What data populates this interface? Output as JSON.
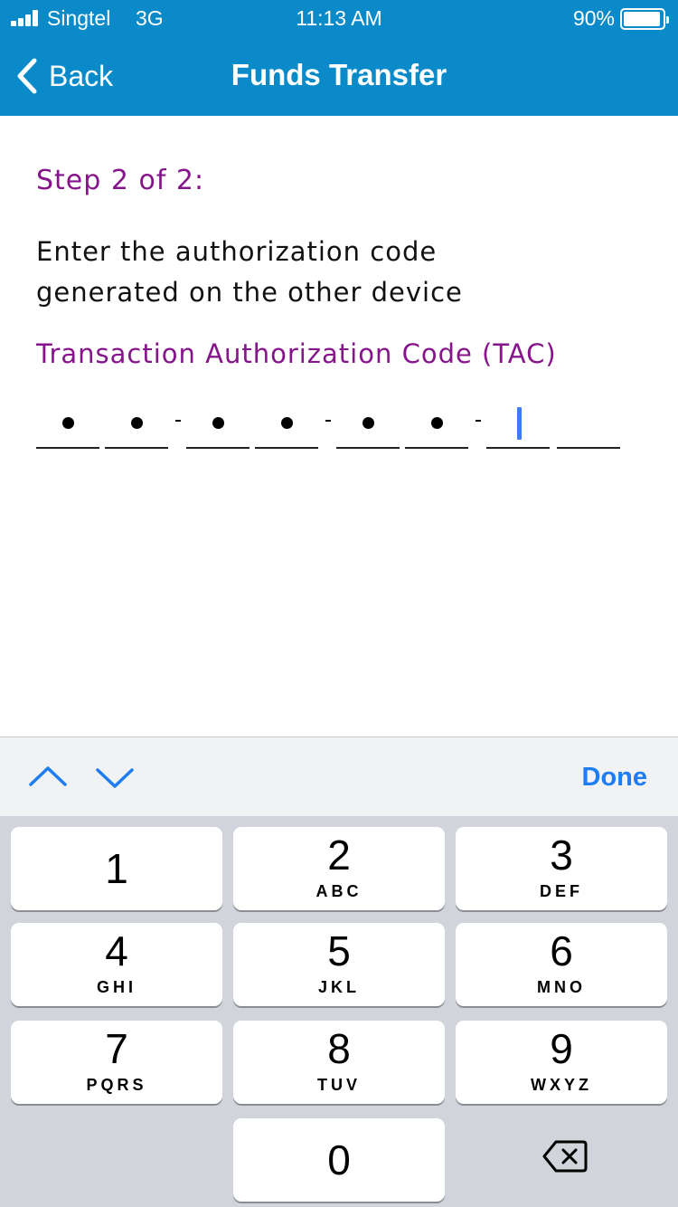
{
  "status_bar": {
    "carrier": "Singtel",
    "network": "3G",
    "time": "11:13 AM",
    "battery_percent": "90%",
    "battery_level": 0.9,
    "signal_bars": 4
  },
  "nav": {
    "back_label": "Back",
    "title": "Funds Transfer"
  },
  "content": {
    "step": "Step 2 of 2:",
    "instruction_line1": "Enter the authorization code",
    "instruction_line2": "generated on the other device",
    "tac_label": "Transaction Authorization Code (TAC)"
  },
  "tac": {
    "filled_digits": 6,
    "total_digits": 8
  },
  "accessory": {
    "prev_icon": "chevron-up-icon",
    "next_icon": "chevron-down-icon",
    "done_label": "Done"
  },
  "keypad": {
    "keys": [
      {
        "digit": "1",
        "letters": ""
      },
      {
        "digit": "2",
        "letters": "ABC"
      },
      {
        "digit": "3",
        "letters": "DEF"
      },
      {
        "digit": "4",
        "letters": "GHI"
      },
      {
        "digit": "5",
        "letters": "JKL"
      },
      {
        "digit": "6",
        "letters": "MNO"
      },
      {
        "digit": "7",
        "letters": "PQRS"
      },
      {
        "digit": "8",
        "letters": "TUV"
      },
      {
        "digit": "9",
        "letters": "WXYZ"
      },
      {
        "digit": "0",
        "letters": ""
      }
    ],
    "delete_icon": "backspace-icon"
  },
  "colors": {
    "header_bg": "#0b8ac9",
    "accent_purple": "#86148a",
    "done_blue": "#1e7df2",
    "cursor_blue": "#3e7bf7",
    "keypad_bg": "#d1d4da"
  }
}
